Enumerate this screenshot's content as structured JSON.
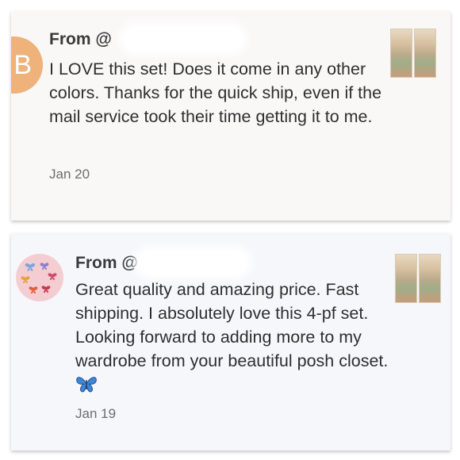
{
  "reviews": [
    {
      "avatar_letter": "B",
      "from_prefix": "From @",
      "message": "I LOVE this set! Does it come in any other colors. Thanks for the quick ship, even if the mail service took their time getting it to me.",
      "date": "Jan 20"
    },
    {
      "avatar_icon": "butterflies-icon",
      "from_prefix": "From @",
      "message": "Great quality and amazing price. Fast shipping. I absolutely love this 4-pf set. Looking forward to adding more to my wardrobe from your beautiful posh closet.",
      "message_emoji": "butterfly-emoji",
      "date": "Jan 19"
    }
  ],
  "colors": {
    "avatar_b_bg": "#eeb27a",
    "avatar_butterfly_bg": "#f4cdd2",
    "butterfly_blue": "#3f86d6"
  }
}
